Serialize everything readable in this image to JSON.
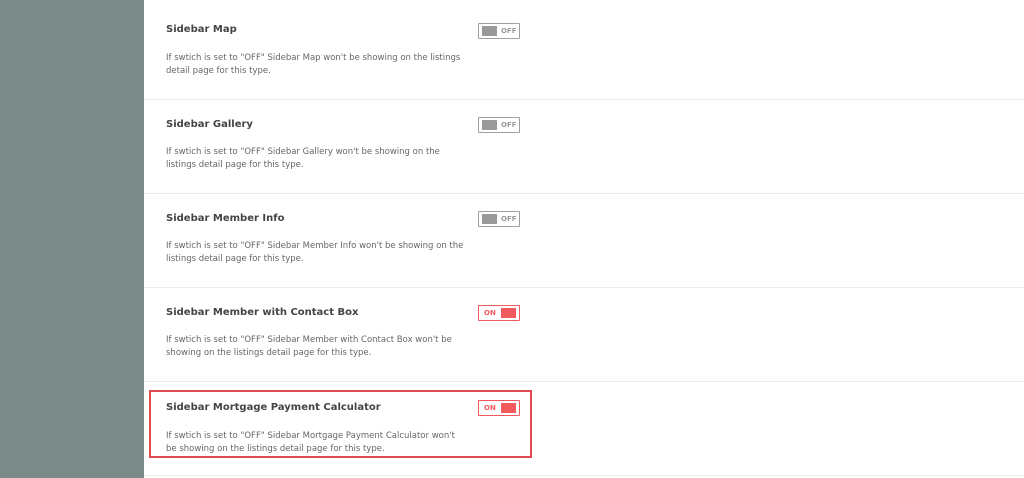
{
  "settings": {
    "items": [
      {
        "title": "Sidebar Map",
        "description": "If swtich is set to \"OFF\" Sidebar Map won't be showing on the listings detail page for this type.",
        "toggle": "OFF"
      },
      {
        "title": "Sidebar Gallery",
        "description": "If swtich is set to \"OFF\" Sidebar Gallery won't be showing on the listings detail page for this type.",
        "toggle": "OFF"
      },
      {
        "title": "Sidebar Member Info",
        "description": "If swtich is set to \"OFF\" Sidebar Member Info won't be showing on the listings detail page for this type.",
        "toggle": "OFF"
      },
      {
        "title": "Sidebar Member with Contact Box",
        "description": "If swtich is set to \"OFF\" Sidebar Member with Contact Box won't be showing on the listings detail page for this type.",
        "toggle": "ON"
      },
      {
        "title": "Sidebar Mortgage Payment Calculator",
        "description": "If swtich is set to \"OFF\" Sidebar Mortgage Payment Calculator won't be showing on the listings detail page for this type.",
        "toggle": "ON"
      }
    ]
  },
  "colors": {
    "sidebar": "#7b8a88",
    "accent_on": "#f05a5e",
    "toggle_off": "#9a9a9a",
    "highlight": "#e04a4f"
  }
}
